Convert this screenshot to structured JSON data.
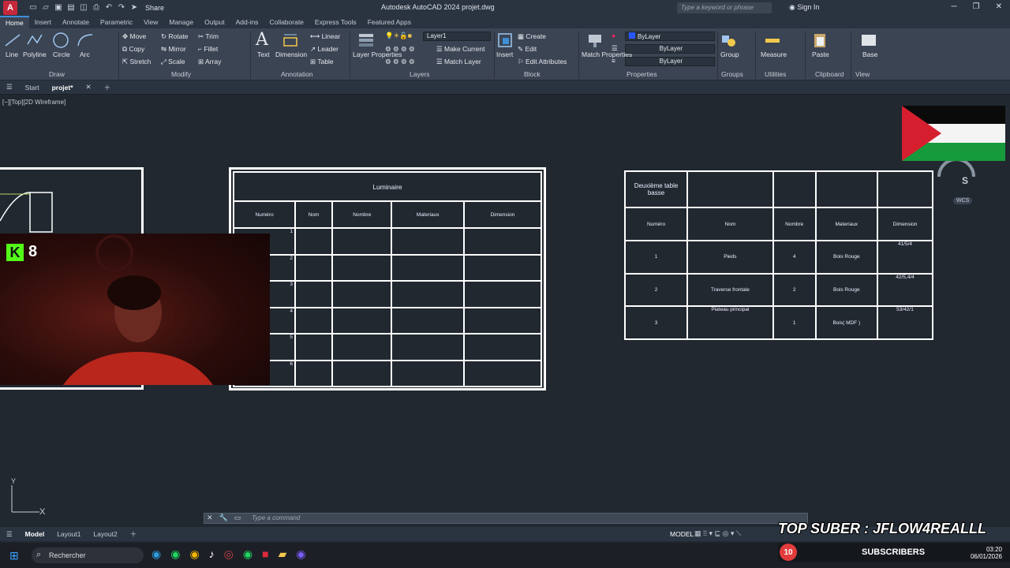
{
  "app": {
    "title": "Autodesk AutoCAD 2024   projet.dwg",
    "logo": "A",
    "share_label": "Share",
    "search_placeholder": "Type a keyword or phrase",
    "sign_in": "Sign In"
  },
  "ribbon_tabs": [
    "Home",
    "Insert",
    "Annotate",
    "Parametric",
    "View",
    "Manage",
    "Output",
    "Add-ins",
    "Collaborate",
    "Express Tools",
    "Featured Apps"
  ],
  "ribbon": {
    "draw": {
      "line": "Line",
      "polyline": "Polyline",
      "circle": "Circle",
      "arc": "Arc",
      "label": "Draw"
    },
    "modify": {
      "move": "Move",
      "rotate": "Rotate",
      "trim": "Trim",
      "copy": "Copy",
      "mirror": "Mirror",
      "fillet": "Fillet",
      "stretch": "Stretch",
      "scale": "Scale",
      "array": "Array",
      "label": "Modify"
    },
    "annotation": {
      "text": "Text",
      "dimension": "Dimension",
      "linear": "Linear",
      "leader": "Leader",
      "table": "Table",
      "label": "Annotation"
    },
    "layers": {
      "properties": "Layer Properties",
      "current_layer": "Layer1",
      "make_current": "Make Current",
      "match_layer": "Match Layer",
      "label": "Layers"
    },
    "block": {
      "insert": "Insert",
      "create": "Create",
      "edit": "Edit",
      "edit_attributes": "Edit Attributes",
      "label": "Block"
    },
    "properties": {
      "match": "Match Properties",
      "color": "ByLayer",
      "linetype": "ByLayer",
      "lineweight": "ByLayer",
      "label": "Properties"
    },
    "groups": {
      "group": "Group",
      "label": "Groups"
    },
    "utilities": {
      "measure": "Measure",
      "label": "Utilities"
    },
    "clipboard": {
      "paste": "Paste",
      "label": "Clipboard"
    },
    "view": {
      "base": "Base",
      "label": "View"
    }
  },
  "doc_tabs": {
    "start": "Start",
    "active": "projet*"
  },
  "viewport_label": "[−][Top][2D Wireframe]",
  "table_luminaire": {
    "title": "Luminaire",
    "headers": [
      "Numéro",
      "Nom",
      "Nombre",
      "Materiaux",
      "Dimension"
    ],
    "row_numbers": [
      "1",
      "2",
      "3",
      "4",
      "5",
      "6"
    ]
  },
  "table_basse": {
    "title": "Deuxième table basse",
    "headers": [
      "Numéro",
      "Nom",
      "Nombre",
      "Materiaux",
      "Dimension"
    ],
    "rows": [
      {
        "num": "1",
        "nom": "Pieds",
        "nombre": "4",
        "mat": "Bois Rouge",
        "dim": "41/5/4"
      },
      {
        "num": "2",
        "nom": "Traverse frontale",
        "nombre": "2",
        "mat": "Bois Rouge",
        "dim": "42/5,4/4"
      },
      {
        "num": "3",
        "nom": "Plateau principal",
        "nombre": "1",
        "mat": "Bois( MDF )",
        "dim": "53/42/1"
      }
    ]
  },
  "viewcube": {
    "face": "S",
    "ucs": "WCS"
  },
  "ucs_icon": {
    "y": "Y",
    "x": "X"
  },
  "stream": {
    "kick_count": "8",
    "top_suber": "TOP SUBER : JFLOW4REALLL",
    "sub_count": "10",
    "sub_label": "SUBSCRIBERS"
  },
  "command_placeholder": "Type a command",
  "layout_tabs": [
    "Model",
    "Layout1",
    "Layout2"
  ],
  "status": {
    "model": "MODEL"
  },
  "taskbar": {
    "search": "Rechercher",
    "time": "03:20",
    "date": "06/01/2026"
  }
}
